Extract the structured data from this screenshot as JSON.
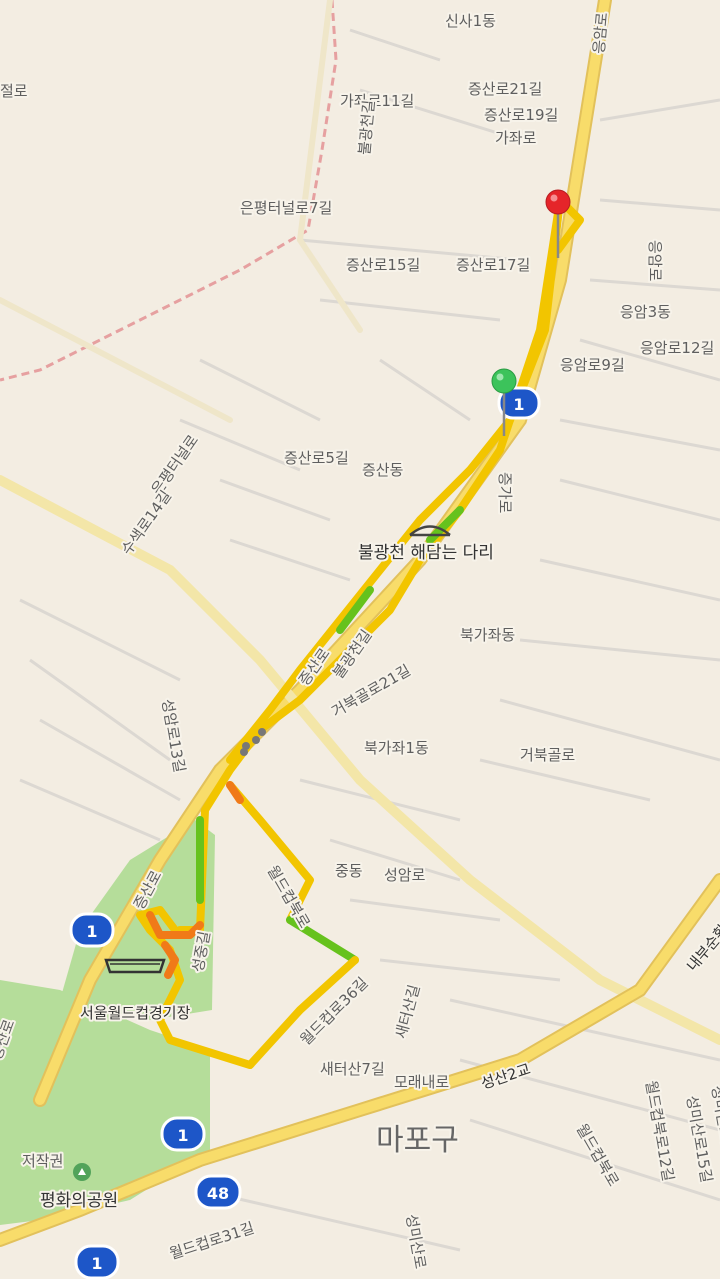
{
  "map": {
    "district_label": "마포구",
    "landmarks": {
      "bridge": "불광천 해담는 다리",
      "stadium": "서울월드컵경기장",
      "park": "평화의공원",
      "park_label": "저작권"
    },
    "route_shields": [
      "1",
      "1",
      "1",
      "48",
      "1"
    ],
    "markers": [
      {
        "name": "start",
        "color": "#3cc35b"
      },
      {
        "name": "end",
        "color": "#e5252a"
      }
    ],
    "street_labels": [
      "신사1동",
      "증산로21길",
      "증산로19길",
      "가좌로",
      "가좌로11길",
      "은평터널로7길",
      "증산로15길",
      "증산로17길",
      "응암로",
      "응암로9길",
      "응암3동",
      "응암로12길",
      "증산로5길",
      "증산동",
      "증가로",
      "은평터널로",
      "수색로14길",
      "증산로",
      "불광천길",
      "거북골로21길",
      "북가좌동",
      "북가좌1동",
      "거북골로",
      "성암로13길",
      "중동",
      "성암로",
      "월드컵북로",
      "성중길",
      "월드컵로36길",
      "새터산길",
      "새터산7길",
      "모래내로",
      "성산2교",
      "내부순환로",
      "월드컵북로12길",
      "성미산로19길",
      "성미산로15길",
      "월드컵로31길",
      "성미산로",
      "월드컵북로",
      "증산로",
      "절로",
      "응암로",
      "불광천길",
      "증산로"
    ],
    "colors": {
      "land": "#f3ede2",
      "major_road": "#f7d65a",
      "park": "#b5dd9a",
      "boundary": "#e6a0a0",
      "route_yellow": "#f2c500",
      "route_green": "#66c21d",
      "route_orange": "#f07a18",
      "shield": "#1d56c8"
    }
  }
}
